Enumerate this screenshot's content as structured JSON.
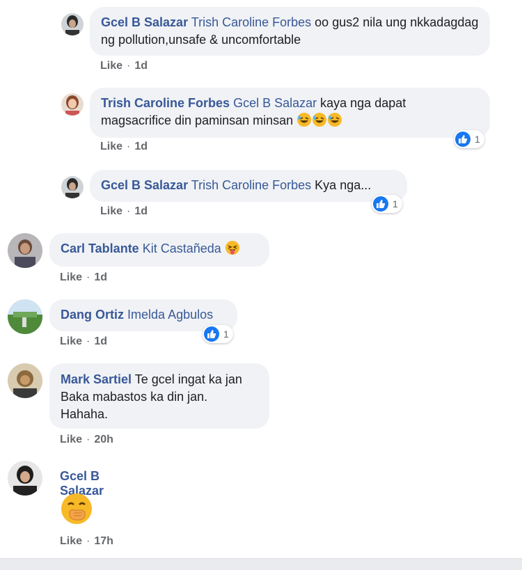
{
  "comments": [
    {
      "author": "Gcel B Salazar",
      "tag": "Trish Caroline Forbes",
      "text": "oo gus2 nila ung nkkadagdag ng pollution,unsafe & uncomfortable",
      "like": "Like",
      "time": "1d"
    },
    {
      "author": "Trish Caroline Forbes",
      "tag": "Gcel B Salazar",
      "text": "kaya nga dapat magsacrifice din paminsan minsan",
      "emojis": [
        "rolling-laughing-emoji",
        "rolling-laughing-emoji",
        "rolling-laughing-emoji"
      ],
      "like": "Like",
      "time": "1d",
      "reaction_count": "1"
    },
    {
      "author": "Gcel B Salazar",
      "tag": "Trish Caroline Forbes",
      "text": "Kya nga...",
      "like": "Like",
      "time": "1d",
      "reaction_count": "1"
    },
    {
      "author": "Carl Tablante",
      "tag": "Kit Castañeda",
      "emojis": [
        "tongue-out-emoji"
      ],
      "like": "Like",
      "time": "1d"
    },
    {
      "author": "Dang Ortiz",
      "tag": "Imelda Agbulos",
      "like": "Like",
      "time": "1d",
      "reaction_count": "1"
    },
    {
      "author": "Mark Sartiel",
      "text_lines": [
        "Te gcel ingat ka jan",
        "Baka mabastos ka din jan.",
        "Hahaha."
      ],
      "like": "Like",
      "time": "20h"
    },
    {
      "author": "Gcel B Salazar",
      "emojis": [
        "hand-over-mouth-emoji"
      ],
      "like": "Like",
      "time": "17h"
    }
  ],
  "meta": {
    "separator": "·"
  },
  "colors": {
    "name": "#385898",
    "bubble": "#f0f2f5",
    "like_badge": "#1877f2",
    "meta": "#65676b"
  }
}
